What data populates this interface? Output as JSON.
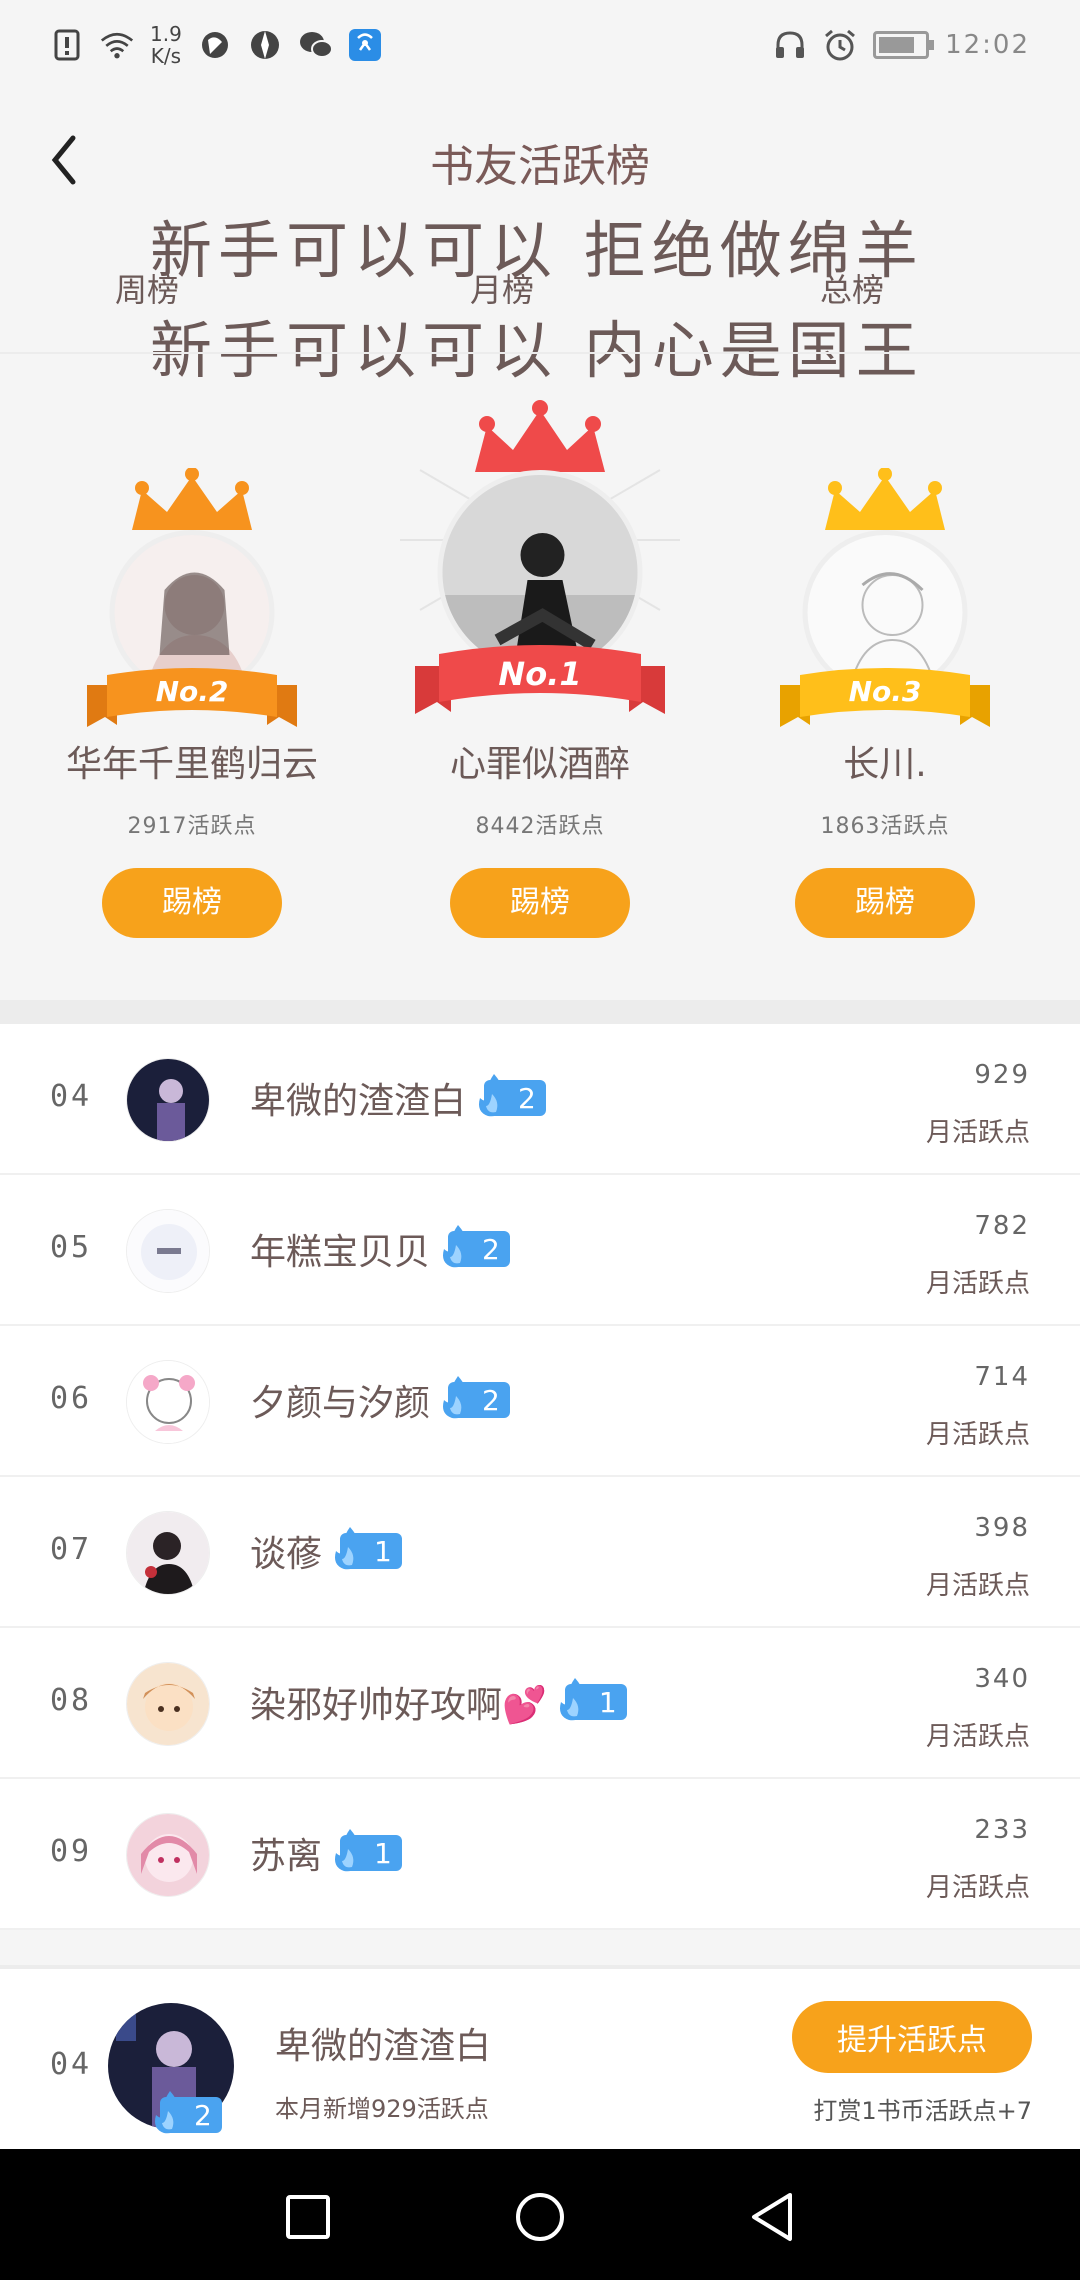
{
  "status_bar": {
    "speed_value": "1.9",
    "speed_unit": "K/s",
    "time": "12:02",
    "icons": [
      "alert-icon",
      "wifi-icon",
      "app-icon",
      "app-icon",
      "wechat-icon",
      "hotspot-icon",
      "headset-icon",
      "alarm-icon",
      "battery-icon"
    ],
    "battery_level": 0.7
  },
  "header": {
    "title": "书友活跃榜",
    "banner_line1": "新手可以可以 拒绝做绵羊",
    "banner_line2": "新手可以可以 内心是国王",
    "tabs": [
      "周榜",
      "月榜",
      "总榜"
    ]
  },
  "podium": [
    {
      "rank_label": "No.2",
      "name": "华年千里鹤归云",
      "points": "2917活跃点",
      "button": "踢榜",
      "crown_color": "#f7931e",
      "ribbon_color": "#f7931e"
    },
    {
      "rank_label": "No.1",
      "name": "心罪似酒醉",
      "points": "8442活跃点",
      "button": "踢榜",
      "crown_color": "#ef4a4a",
      "ribbon_color": "#ef4a4a"
    },
    {
      "rank_label": "No.3",
      "name": "长川.",
      "points": "1863活跃点",
      "button": "踢榜",
      "crown_color": "#ffbf1a",
      "ribbon_color": "#ffbf1a"
    }
  ],
  "list": [
    {
      "rank": "04",
      "name": "卑微的渣渣白",
      "level": "2",
      "points": "929",
      "label": "月活跃点"
    },
    {
      "rank": "05",
      "name": "年糕宝贝贝",
      "level": "2",
      "points": "782",
      "label": "月活跃点"
    },
    {
      "rank": "06",
      "name": "夕颜与汐颜",
      "level": "2",
      "points": "714",
      "label": "月活跃点"
    },
    {
      "rank": "07",
      "name": "谈蓚",
      "level": "1",
      "points": "398",
      "label": "月活跃点"
    },
    {
      "rank": "08",
      "name": "染邪好帅好攻啊💕",
      "level": "1",
      "points": "340",
      "label": "月活跃点"
    },
    {
      "rank": "09",
      "name": "苏离",
      "level": "1",
      "points": "233",
      "label": "月活跃点"
    }
  ],
  "my_rank": {
    "rank": "04",
    "name": "卑微的渣渣白",
    "level": "2",
    "subtitle": "本月新增929活跃点",
    "boost_button": "提升活跃点",
    "boost_note": "打赏1书币活跃点+7"
  },
  "colors": {
    "accent_orange": "#f7a21b",
    "badge_blue": "#4aa3f0",
    "text": "#6c5a58"
  }
}
